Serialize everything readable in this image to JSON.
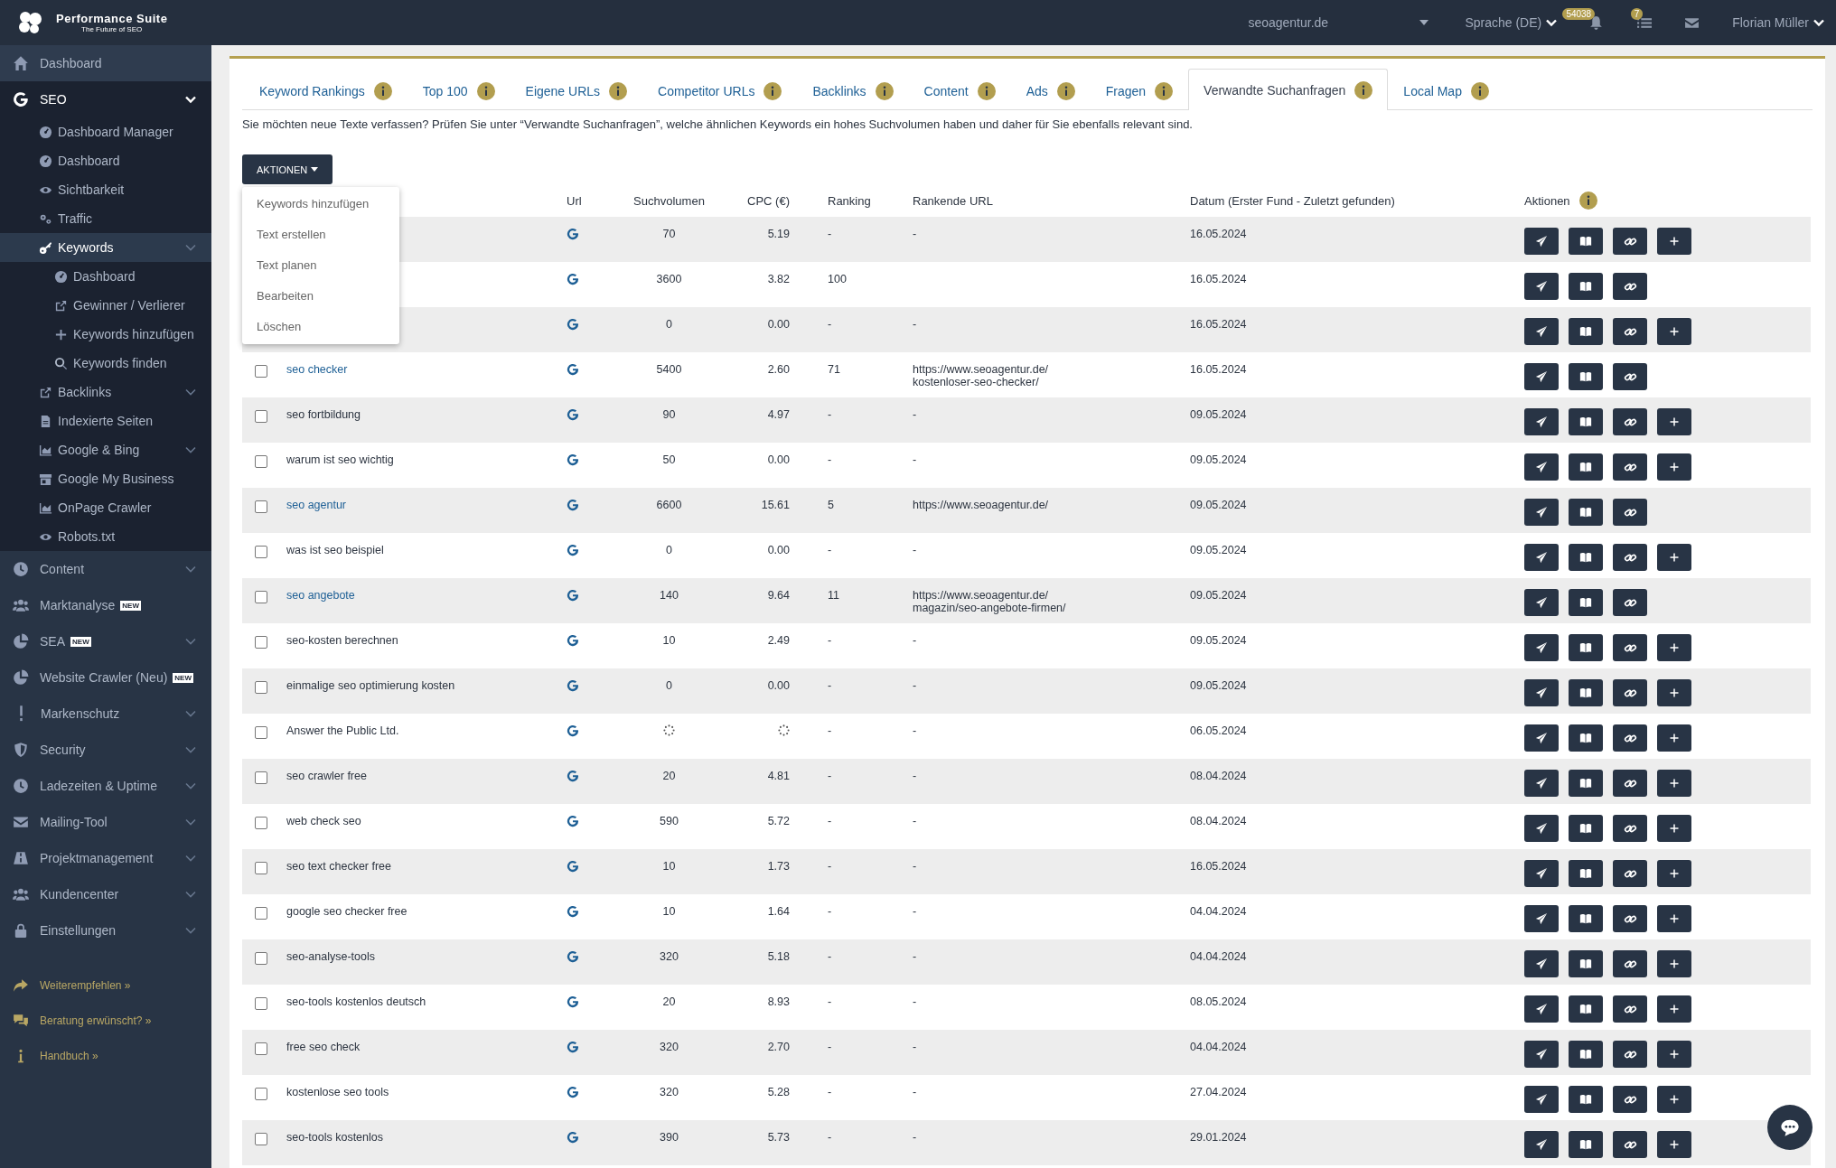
{
  "topbar": {
    "brand": "Performance Suite",
    "tagline": "The Future of SEO",
    "domain": "seoagentur.de",
    "language": "Sprache (DE)",
    "notifications_badge": "54038",
    "tasks_badge": "7",
    "user": "Florian Müller"
  },
  "sidebar": {
    "items": [
      {
        "label": "Dashboard",
        "selected": false
      },
      {
        "label": "SEO",
        "selected": true,
        "expanded": true,
        "children": [
          {
            "label": "Dashboard Manager",
            "selected": false
          },
          {
            "label": "Dashboard",
            "selected": false
          },
          {
            "label": "Sichtbarkeit",
            "selected": false
          },
          {
            "label": "Traffic",
            "selected": false
          },
          {
            "label": "Keywords",
            "selected": true,
            "expanded": true,
            "children": [
              {
                "label": "Dashboard",
                "selected": false
              },
              {
                "label": "Gewinner / Verlierer",
                "selected": false
              },
              {
                "label": "Keywords hinzufügen",
                "selected": false
              },
              {
                "label": "Keywords finden",
                "selected": false
              }
            ]
          },
          {
            "label": "Backlinks",
            "selected": false,
            "kind": "submenu"
          },
          {
            "label": "Indexierte Seiten",
            "selected": false
          },
          {
            "label": "Google & Bing",
            "selected": false,
            "kind": "submenu"
          },
          {
            "label": "Google My Business",
            "selected": false
          },
          {
            "label": "OnPage Crawler",
            "selected": false
          },
          {
            "label": "Robots.txt",
            "selected": false
          }
        ]
      },
      {
        "label": "Content",
        "selected": false,
        "kind": "submenu"
      },
      {
        "label": "Marktanalyse",
        "selected": false,
        "badge": "NEW",
        "kind": "link"
      },
      {
        "label": "SEA",
        "selected": false,
        "badge": "NEW",
        "kind": "submenu"
      },
      {
        "label": "Website Crawler (Neu)",
        "selected": false,
        "badge": "NEW",
        "kind": "submenu"
      },
      {
        "label": "Markenschutz",
        "selected": false,
        "kind": "submenu"
      },
      {
        "label": "Security",
        "selected": false,
        "kind": "submenu"
      },
      {
        "label": "Ladezeiten & Uptime",
        "selected": false,
        "kind": "submenu"
      },
      {
        "label": "Mailing-Tool",
        "selected": false,
        "kind": "submenu"
      },
      {
        "label": "Projektmanagement",
        "selected": false,
        "kind": "submenu"
      },
      {
        "label": "Kundencenter",
        "selected": false,
        "kind": "submenu"
      },
      {
        "label": "Einstellungen",
        "selected": false,
        "kind": "submenu"
      }
    ],
    "footer_links": [
      "Weiterempfehlen »",
      "Beratung erwünscht? »",
      "Handbuch »"
    ]
  },
  "tabs": [
    {
      "label": "Keyword Rankings",
      "selected": false
    },
    {
      "label": "Top 100",
      "selected": false
    },
    {
      "label": "Eigene URLs",
      "selected": false
    },
    {
      "label": "Competitor URLs",
      "selected": false
    },
    {
      "label": "Backlinks",
      "selected": false
    },
    {
      "label": "Content",
      "selected": false
    },
    {
      "label": "Ads",
      "selected": false
    },
    {
      "label": "Fragen",
      "selected": false
    },
    {
      "label": "Verwandte Suchanfragen",
      "selected": true
    },
    {
      "label": "Local Map",
      "selected": false
    }
  ],
  "description": "Sie möchten neue Texte verfassen? Prüfen Sie unter “Verwandte Suchanfragen”, welche ähnlichen Keywords ein hohes Suchvolumen haben und daher für Sie ebenfalls relevant sind.",
  "actions_button": "AKTIONEN",
  "actions_menu": [
    "Keywords hinzufügen",
    "Text erstellen",
    "Text planen",
    "Bearbeiten",
    "Löschen"
  ],
  "table": {
    "columns": [
      "Url",
      "Suchvolumen",
      "CPC (€)",
      "Ranking",
      "Rankende URL",
      "Datum (Erster Fund - Zuletzt gefunden)",
      "Aktionen"
    ],
    "rows": [
      {
        "volume": "70",
        "cpc": "5.19",
        "ranking": "-",
        "ranking_url": [
          "-"
        ],
        "date": "16.05.2024",
        "can_add": true
      },
      {
        "volume": "3600",
        "cpc": "3.82",
        "ranking": "100",
        "date": "16.05.2024",
        "can_add": false
      },
      {
        "volume": "0",
        "cpc": "0.00",
        "ranking": "-",
        "ranking_url": [
          "-"
        ],
        "date": "16.05.2024",
        "can_add": true
      },
      {
        "keyword": "seo checker",
        "linked": true,
        "checked": false,
        "volume": "5400",
        "cpc": "2.60",
        "ranking": "71",
        "ranking_url": [
          "https://www.seoagentur.de/",
          "kostenloser-seo-checker/"
        ],
        "date": "16.05.2024",
        "can_add": false
      },
      {
        "keyword": "seo fortbildung",
        "linked": false,
        "checked": false,
        "volume": "90",
        "cpc": "4.97",
        "ranking": "-",
        "ranking_url": [
          "-"
        ],
        "date": "09.05.2024",
        "can_add": true
      },
      {
        "keyword": "warum ist seo wichtig",
        "linked": false,
        "checked": false,
        "volume": "50",
        "cpc": "0.00",
        "ranking": "-",
        "ranking_url": [
          "-"
        ],
        "date": "09.05.2024",
        "can_add": true
      },
      {
        "keyword": "seo agentur",
        "linked": true,
        "checked": false,
        "volume": "6600",
        "cpc": "15.61",
        "ranking": "5",
        "ranking_url": [
          "https://www.seoagentur.de/"
        ],
        "date": "09.05.2024",
        "can_add": false
      },
      {
        "keyword": "was ist seo beispiel",
        "linked": false,
        "checked": false,
        "volume": "0",
        "cpc": "0.00",
        "ranking": "-",
        "ranking_url": [
          "-"
        ],
        "date": "09.05.2024",
        "can_add": true
      },
      {
        "keyword": "seo angebote",
        "linked": true,
        "checked": false,
        "volume": "140",
        "cpc": "9.64",
        "ranking": "11",
        "ranking_url": [
          "https://www.seoagentur.de/",
          "magazin/seo-angebote-firmen/"
        ],
        "date": "09.05.2024",
        "can_add": false
      },
      {
        "keyword": "seo-kosten berechnen",
        "linked": false,
        "checked": false,
        "volume": "10",
        "cpc": "2.49",
        "ranking": "-",
        "ranking_url": [
          "-"
        ],
        "date": "09.05.2024",
        "can_add": true
      },
      {
        "keyword": "einmalige seo optimierung kosten",
        "linked": false,
        "checked": false,
        "volume": "0",
        "cpc": "0.00",
        "ranking": "-",
        "ranking_url": [
          "-"
        ],
        "date": "09.05.2024",
        "can_add": true
      },
      {
        "keyword": "Answer the Public Ltd.",
        "linked": false,
        "checked": false,
        "loading": true,
        "ranking": "-",
        "ranking_url": [
          "-"
        ],
        "date": "06.05.2024",
        "can_add": true
      },
      {
        "keyword": "seo crawler free",
        "linked": false,
        "checked": false,
        "volume": "20",
        "cpc": "4.81",
        "ranking": "-",
        "ranking_url": [
          "-"
        ],
        "date": "08.04.2024",
        "can_add": true
      },
      {
        "keyword": "web check seo",
        "linked": false,
        "checked": false,
        "volume": "590",
        "cpc": "5.72",
        "ranking": "-",
        "ranking_url": [
          "-"
        ],
        "date": "08.04.2024",
        "can_add": true
      },
      {
        "keyword": "seo text checker free",
        "linked": false,
        "checked": false,
        "volume": "10",
        "cpc": "1.73",
        "ranking": "-",
        "ranking_url": [
          "-"
        ],
        "date": "16.05.2024",
        "can_add": true
      },
      {
        "keyword": "google seo checker free",
        "linked": false,
        "checked": false,
        "volume": "10",
        "cpc": "1.64",
        "ranking": "-",
        "ranking_url": [
          "-"
        ],
        "date": "04.04.2024",
        "can_add": true
      },
      {
        "keyword": "seo-analyse-tools",
        "linked": false,
        "checked": false,
        "volume": "320",
        "cpc": "5.18",
        "ranking": "-",
        "ranking_url": [
          "-"
        ],
        "date": "04.04.2024",
        "can_add": true
      },
      {
        "keyword": "seo-tools kostenlos deutsch",
        "linked": false,
        "checked": false,
        "volume": "20",
        "cpc": "8.93",
        "ranking": "-",
        "ranking_url": [
          "-"
        ],
        "date": "08.05.2024",
        "can_add": true
      },
      {
        "keyword": "free seo check",
        "linked": false,
        "checked": false,
        "volume": "320",
        "cpc": "2.70",
        "ranking": "-",
        "ranking_url": [
          "-"
        ],
        "date": "04.04.2024",
        "can_add": true
      },
      {
        "keyword": "kostenlose seo tools",
        "linked": false,
        "checked": false,
        "volume": "320",
        "cpc": "5.28",
        "ranking": "-",
        "ranking_url": [
          "-"
        ],
        "date": "27.04.2024",
        "can_add": true
      },
      {
        "keyword": "seo-tools kostenlos",
        "linked": false,
        "checked": false,
        "volume": "390",
        "cpc": "5.73",
        "ranking": "-",
        "ranking_url": [
          "-"
        ],
        "date": "29.01.2024",
        "can_add": true
      }
    ]
  }
}
